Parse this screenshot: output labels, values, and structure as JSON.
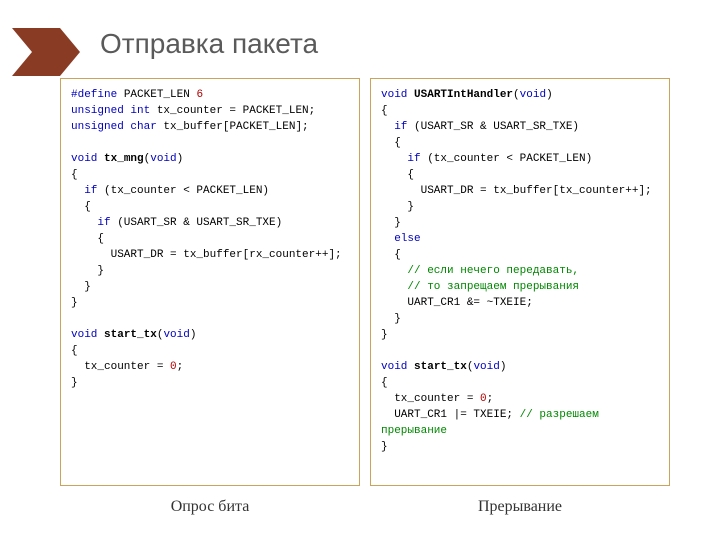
{
  "title": "Отправка пакета",
  "caption_left": "Опрос бита",
  "caption_right": "Прерывание",
  "left": {
    "l1a": "#define",
    "l1b": " PACKET_LEN ",
    "l1c": "6",
    "l2a": "unsigned int",
    "l2b": " tx_counter = PACKET_LEN;",
    "l3a": "unsigned char",
    "l3b": " tx_buffer[PACKET_LEN];",
    "l5a": "void",
    "l5b": " ",
    "l5c": "tx_mng",
    "l5d": "(",
    "l5e": "void",
    "l5f": ")",
    "l6": "{",
    "l7a": "  ",
    "l7b": "if",
    "l7c": " (tx_counter < PACKET_LEN)",
    "l8": "  {",
    "l9a": "    ",
    "l9b": "if",
    "l9c": " (USART_SR & USART_SR_TXE)",
    "l10": "    {",
    "l11": "      USART_DR = tx_buffer[rx_counter++];",
    "l12": "    }",
    "l13": "  }",
    "l14": "}",
    "l16a": "void",
    "l16b": " ",
    "l16c": "start_tx",
    "l16d": "(",
    "l16e": "void",
    "l16f": ")",
    "l17": "{",
    "l18a": "  tx_counter = ",
    "l18b": "0",
    "l18c": ";",
    "l19": "}"
  },
  "right": {
    "l1a": "void",
    "l1b": " ",
    "l1c": "USARTIntHandler",
    "l1d": "(",
    "l1e": "void",
    "l1f": ")",
    "l2": "{",
    "l3a": "  ",
    "l3b": "if",
    "l3c": " (USART_SR & USART_SR_TXE)",
    "l4": "  {",
    "l5a": "    ",
    "l5b": "if",
    "l5c": " (tx_counter < PACKET_LEN)",
    "l6": "    {",
    "l7": "      USART_DR = tx_buffer[tx_counter++];",
    "l8": "    }",
    "l9": "  }",
    "l10a": "  ",
    "l10b": "else",
    "l11": "  {",
    "l12a": "    ",
    "l12b": "// если нечего передавать,",
    "l13a": "    ",
    "l13b": "// то запрещаем прерывания",
    "l14": "    UART_CR1 &= ~TXEIE;",
    "l15": "  }",
    "l16": "}",
    "l18a": "void",
    "l18b": " ",
    "l18c": "start_tx",
    "l18d": "(",
    "l18e": "void",
    "l18f": ")",
    "l19": "{",
    "l20a": "  tx_counter = ",
    "l20b": "0",
    "l20c": ";",
    "l21a": "  UART_CR1 |= TXEIE; ",
    "l21b": "// разрешаем",
    "l22": "прерывание",
    "l23": "}"
  }
}
